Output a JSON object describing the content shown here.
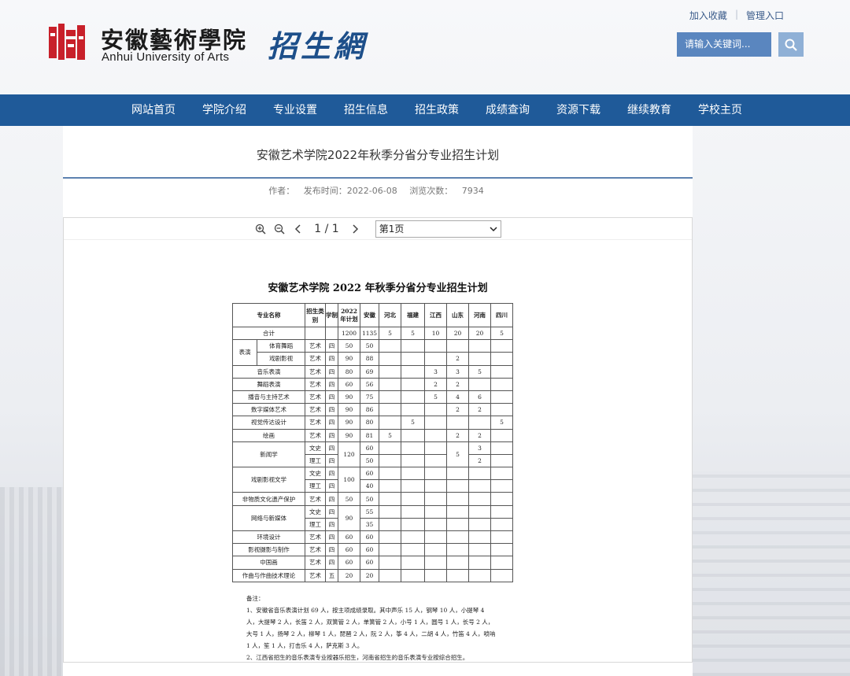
{
  "header": {
    "school_cn": "安徽藝術學院",
    "school_en": "Anhui University of Arts",
    "site_name": "招生網",
    "top_links": [
      "加入收藏",
      "管理入口"
    ],
    "search_placeholder": "请输入关键词...",
    "brand_red": "#c8202a",
    "brand_blue": "#1f5a99"
  },
  "nav": [
    "网站首页",
    "学院介绍",
    "专业设置",
    "招生信息",
    "招生政策",
    "成绩查询",
    "资源下载",
    "继续教育",
    "学校主页"
  ],
  "article": {
    "title": "安徽艺术学院2022年秋季分省分专业招生计划",
    "author_label": "作者：",
    "date_label": "发布时间：2022-06-08",
    "views_label": "浏览次数：",
    "views": "7934"
  },
  "viewer": {
    "page_indicator": "1 / 1",
    "page_select": "第1页"
  },
  "doc": {
    "title": "安徽艺术学院 2022 年秋季分省分专业招生计划",
    "headers": [
      "专业名称",
      "招生类别",
      "学制",
      "2022年计划",
      "安徽",
      "河北",
      "福建",
      "江西",
      "山东",
      "河南",
      "四川"
    ],
    "rows": [
      {
        "name": "合计",
        "sub": "",
        "cat": "",
        "len": "",
        "plan": "1200",
        "ah": "1135",
        "hb": "5",
        "fj": "5",
        "jx": "10",
        "sd": "20",
        "hn": "20",
        "sc": "5"
      },
      {
        "name": "表演",
        "sub": "体育舞蹈",
        "cat": "艺术",
        "len": "四",
        "plan": "50",
        "ah": "50",
        "hb": "",
        "fj": "",
        "jx": "",
        "sd": "",
        "hn": "",
        "sc": ""
      },
      {
        "name": "",
        "sub": "戏剧影视",
        "cat": "艺术",
        "len": "四",
        "plan": "90",
        "ah": "88",
        "hb": "",
        "fj": "",
        "jx": "",
        "sd": "2",
        "hn": "",
        "sc": ""
      },
      {
        "name": "音乐表演",
        "sub": "",
        "cat": "艺术",
        "len": "四",
        "plan": "80",
        "ah": "69",
        "hb": "",
        "fj": "",
        "jx": "3",
        "sd": "3",
        "hn": "5",
        "sc": ""
      },
      {
        "name": "舞蹈表演",
        "sub": "",
        "cat": "艺术",
        "len": "四",
        "plan": "60",
        "ah": "56",
        "hb": "",
        "fj": "",
        "jx": "2",
        "sd": "2",
        "hn": "",
        "sc": ""
      },
      {
        "name": "播音与主持艺术",
        "sub": "",
        "cat": "艺术",
        "len": "四",
        "plan": "90",
        "ah": "75",
        "hb": "",
        "fj": "",
        "jx": "5",
        "sd": "4",
        "hn": "6",
        "sc": ""
      },
      {
        "name": "数字媒体艺术",
        "sub": "",
        "cat": "艺术",
        "len": "四",
        "plan": "90",
        "ah": "86",
        "hb": "",
        "fj": "",
        "jx": "",
        "sd": "2",
        "hn": "2",
        "sc": ""
      },
      {
        "name": "视觉传达设计",
        "sub": "",
        "cat": "艺术",
        "len": "四",
        "plan": "90",
        "ah": "80",
        "hb": "",
        "fj": "5",
        "jx": "",
        "sd": "",
        "hn": "",
        "sc": "5"
      },
      {
        "name": "绘画",
        "sub": "",
        "cat": "艺术",
        "len": "四",
        "plan": "90",
        "ah": "81",
        "hb": "5",
        "fj": "",
        "jx": "",
        "sd": "2",
        "hn": "2",
        "sc": ""
      },
      {
        "name": "新闻学",
        "sub": "",
        "cat": "文史",
        "len": "四",
        "plan": "120",
        "ah": "60",
        "hb": "",
        "fj": "",
        "jx": "",
        "sd": "5",
        "hn": "3",
        "sc": ""
      },
      {
        "name": "",
        "sub": "",
        "cat": "理工",
        "len": "四",
        "plan": "",
        "ah": "50",
        "hb": "",
        "fj": "",
        "jx": "",
        "sd": "",
        "hn": "2",
        "sc": ""
      },
      {
        "name": "戏剧影视文学",
        "sub": "",
        "cat": "文史",
        "len": "四",
        "plan": "100",
        "ah": "60",
        "hb": "",
        "fj": "",
        "jx": "",
        "sd": "",
        "hn": "",
        "sc": ""
      },
      {
        "name": "",
        "sub": "",
        "cat": "理工",
        "len": "四",
        "plan": "",
        "ah": "40",
        "hb": "",
        "fj": "",
        "jx": "",
        "sd": "",
        "hn": "",
        "sc": ""
      },
      {
        "name": "非物质文化遗产保护",
        "sub": "",
        "cat": "艺术",
        "len": "四",
        "plan": "50",
        "ah": "50",
        "hb": "",
        "fj": "",
        "jx": "",
        "sd": "",
        "hn": "",
        "sc": ""
      },
      {
        "name": "网络与新媒体",
        "sub": "",
        "cat": "文史",
        "len": "四",
        "plan": "90",
        "ah": "55",
        "hb": "",
        "fj": "",
        "jx": "",
        "sd": "",
        "hn": "",
        "sc": ""
      },
      {
        "name": "",
        "sub": "",
        "cat": "理工",
        "len": "四",
        "plan": "",
        "ah": "35",
        "hb": "",
        "fj": "",
        "jx": "",
        "sd": "",
        "hn": "",
        "sc": ""
      },
      {
        "name": "环境设计",
        "sub": "",
        "cat": "艺术",
        "len": "四",
        "plan": "60",
        "ah": "60",
        "hb": "",
        "fj": "",
        "jx": "",
        "sd": "",
        "hn": "",
        "sc": ""
      },
      {
        "name": "影视摄影与制作",
        "sub": "",
        "cat": "艺术",
        "len": "四",
        "plan": "60",
        "ah": "60",
        "hb": "",
        "fj": "",
        "jx": "",
        "sd": "",
        "hn": "",
        "sc": ""
      },
      {
        "name": "中国画",
        "sub": "",
        "cat": "艺术",
        "len": "四",
        "plan": "60",
        "ah": "60",
        "hb": "",
        "fj": "",
        "jx": "",
        "sd": "",
        "hn": "",
        "sc": ""
      },
      {
        "name": "作曲与作曲技术理论",
        "sub": "",
        "cat": "艺术",
        "len": "五",
        "plan": "20",
        "ah": "20",
        "hb": "",
        "fj": "",
        "jx": "",
        "sd": "",
        "hn": "",
        "sc": ""
      }
    ],
    "notes": [
      "备注：",
      "1、安徽省音乐表演计划 69 人，按主项成绩录取。其中声乐 15 人，钢琴 10 人，小提琴 4",
      "人，大提琴 2 人，长笛 2 人，双簧管 2 人，单簧管 2 人，小号 1 人，圆号 1 人，长号 2 人，",
      "大号 1 人，扬琴 2 人，柳琴 1 人，琵琶 2 人，阮 2 人，筝 4 人，二胡 4 人，竹笛 4 人，唢呐",
      "1 人，笙 1 人，打击乐 4 人，萨克斯 3 人。",
      "2、江西省招生的音乐表演专业按器乐招生，河南省招生的音乐表演专业按综合招生。"
    ]
  }
}
